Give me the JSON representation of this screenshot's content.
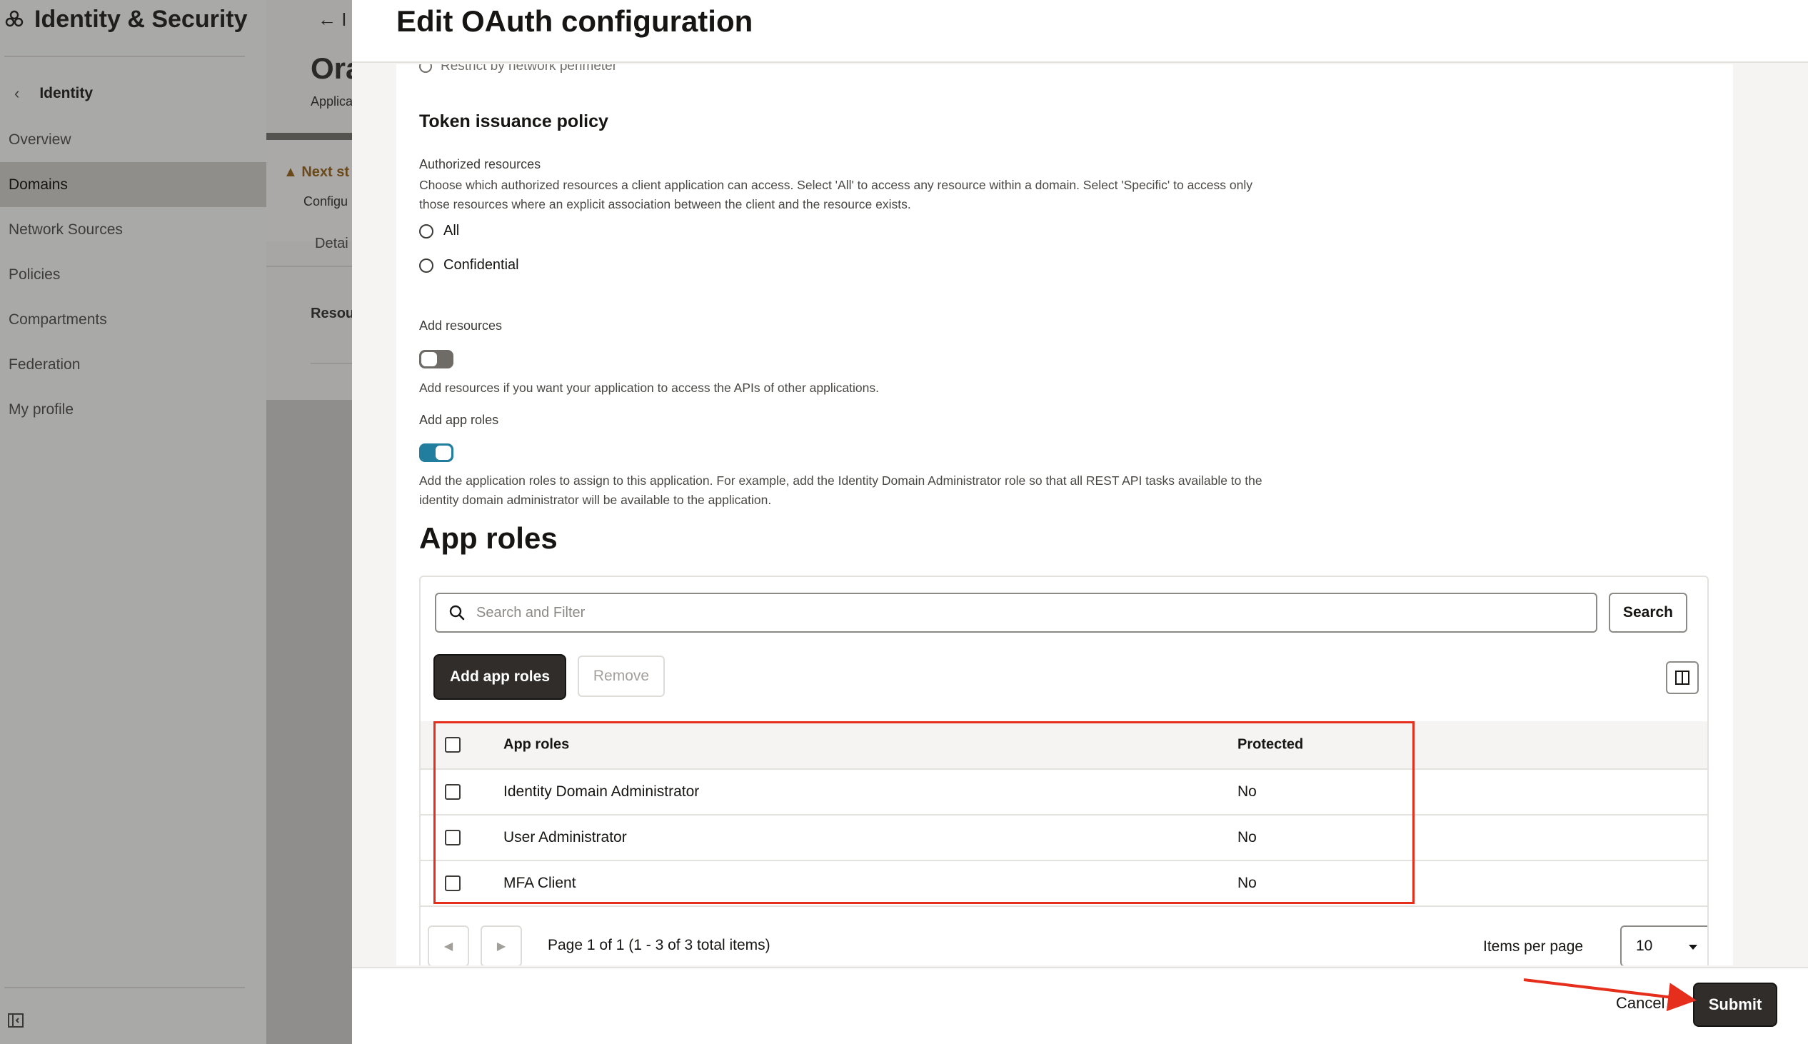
{
  "nav": {
    "app_title": "Identity & Security",
    "back_label": "Identity",
    "items": [
      {
        "label": "Overview"
      },
      {
        "label": "Domains",
        "active": true
      },
      {
        "label": "Network Sources"
      },
      {
        "label": "Policies"
      },
      {
        "label": "Compartments"
      },
      {
        "label": "Federation"
      },
      {
        "label": "My profile"
      }
    ]
  },
  "background_page": {
    "back_arrow": "← I",
    "title": "Ora",
    "subtitle": "Applica",
    "banner_title": "Next st",
    "banner_text": "Configu",
    "tab_label": "Detai",
    "section_label": "Resou"
  },
  "drawer": {
    "title": "Edit OAuth configuration",
    "cutoff_text": "Restrict by network perimeter",
    "token_policy": {
      "title": "Token issuance policy",
      "authorized_label": "Authorized resources",
      "authorized_help": "Choose which authorized resources a client application can access. Select 'All' to access any resource within a domain. Select 'Specific' to access only those resources where an explicit association between the client and the resource exists.",
      "options": [
        {
          "label": "All"
        },
        {
          "label": "Confidential"
        }
      ]
    },
    "add_resources": {
      "label": "Add resources",
      "enabled": false,
      "help": "Add resources if you want your application to access the APIs of other applications."
    },
    "add_app_roles": {
      "label": "Add app roles",
      "enabled": true,
      "help": "Add the application roles to assign to this application. For example, add the Identity Domain Administrator role so that all REST API tasks available to the identity domain administrator will be available to the application."
    },
    "app_roles": {
      "heading": "App roles",
      "search_placeholder": "Search and Filter",
      "search_button": "Search",
      "add_button": "Add app roles",
      "remove_button": "Remove",
      "columns": [
        "App roles",
        "Protected"
      ],
      "rows": [
        {
          "name": "Identity Domain Administrator",
          "protected": "No"
        },
        {
          "name": "User Administrator",
          "protected": "No"
        },
        {
          "name": "MFA Client",
          "protected": "No"
        }
      ],
      "pager_info": "Page 1 of 1 (1 - 3 of 3 total items)",
      "items_per_page_label": "Items per page",
      "items_per_page": "10"
    },
    "footer": {
      "cancel": "Cancel",
      "submit": "Submit"
    }
  },
  "colors": {
    "accent_toggle_on": "#227e9e",
    "primary_button": "#312d2a",
    "annotation_red": "#e52e1c"
  }
}
